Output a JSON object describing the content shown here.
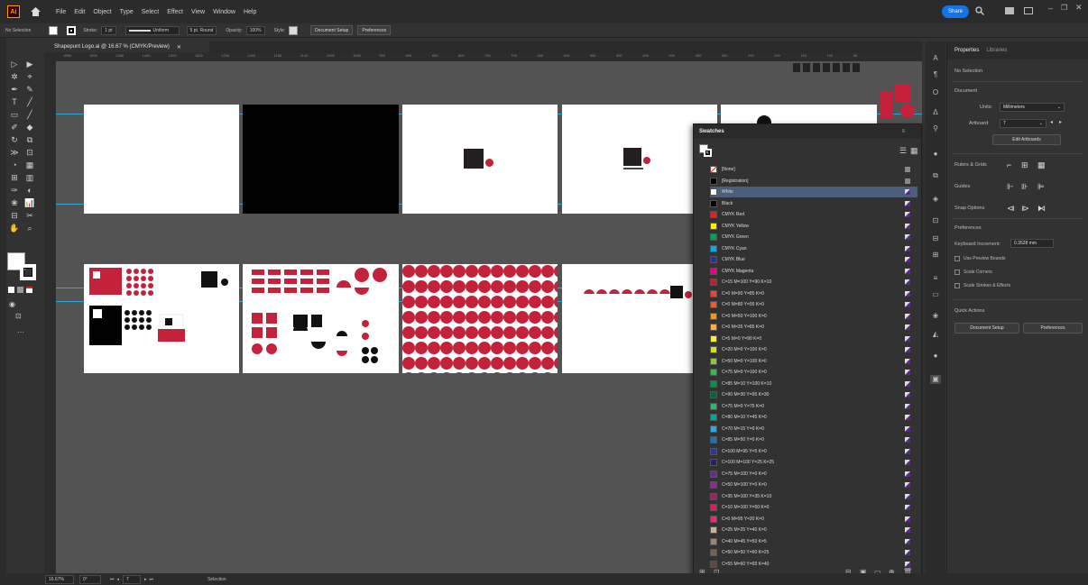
{
  "app": {
    "logo": "Ai"
  },
  "menu": [
    "File",
    "Edit",
    "Object",
    "Type",
    "Select",
    "Effect",
    "View",
    "Window",
    "Help"
  ],
  "share_label": "Share",
  "control_bar": {
    "selection": "No Selection",
    "stroke_label": "Stroke:",
    "stroke_value": "1 pt",
    "profile": "Uniform",
    "brush": "5 pt. Round",
    "opacity_label": "Opacity:",
    "opacity_value": "100%",
    "style_label": "Style:",
    "document_setup": "Document Setup",
    "preferences": "Preferences"
  },
  "document_tab": "Shapepunt Logo.ai @ 16.67 % (CMYK/Preview)",
  "ruler_ticks": [
    "1550",
    "1500",
    "1450",
    "1400",
    "1350",
    "1300",
    "1250",
    "1200",
    "1150",
    "1100",
    "1050",
    "1000",
    "950",
    "900",
    "850",
    "800",
    "750",
    "700",
    "650",
    "600",
    "550",
    "500",
    "450",
    "400",
    "350",
    "300",
    "250",
    "200",
    "150",
    "100",
    "50"
  ],
  "swatches_panel": {
    "title": "Swatches",
    "items": [
      {
        "name": "[None]",
        "color": "none"
      },
      {
        "name": "[Registration]",
        "color": "#000000"
      },
      {
        "name": "White",
        "color": "#ffffff",
        "selected": true
      },
      {
        "name": "Black",
        "color": "#000000"
      },
      {
        "name": "CMYK Red",
        "color": "#ed1c24"
      },
      {
        "name": "CMYK Yellow",
        "color": "#fff200"
      },
      {
        "name": "CMYK Green",
        "color": "#00a651"
      },
      {
        "name": "CMYK Cyan",
        "color": "#00aeef"
      },
      {
        "name": "CMYK Blue",
        "color": "#2e3192"
      },
      {
        "name": "CMYK Magenta",
        "color": "#ec008c"
      },
      {
        "name": "C=15 M=100 Y=90 K=10",
        "color": "#be1e2d"
      },
      {
        "name": "C=0 M=90 Y=85 K=0",
        "color": "#ef4136"
      },
      {
        "name": "C=0 M=80 Y=95 K=0",
        "color": "#f15a29"
      },
      {
        "name": "C=0 M=50 Y=100 K=0",
        "color": "#f7941d"
      },
      {
        "name": "C=0 M=35 Y=85 K=0",
        "color": "#fbb040"
      },
      {
        "name": "C=5 M=0 Y=90 K=0",
        "color": "#f9ed32"
      },
      {
        "name": "C=20 M=0 Y=100 K=0",
        "color": "#d7df23"
      },
      {
        "name": "C=50 M=0 Y=100 K=0",
        "color": "#8dc63f"
      },
      {
        "name": "C=75 M=0 Y=100 K=0",
        "color": "#39b54a"
      },
      {
        "name": "C=85 M=10 Y=100 K=10",
        "color": "#009444"
      },
      {
        "name": "C=90 M=30 Y=95 K=30",
        "color": "#006838"
      },
      {
        "name": "C=75 M=0 Y=75 K=0",
        "color": "#2bb673"
      },
      {
        "name": "C=80 M=10 Y=45 K=0",
        "color": "#00a79d"
      },
      {
        "name": "C=70 M=15 Y=0 K=0",
        "color": "#27aae1"
      },
      {
        "name": "C=85 M=50 Y=0 K=0",
        "color": "#1c75bc"
      },
      {
        "name": "C=100 M=95 Y=5 K=0",
        "color": "#2b3990"
      },
      {
        "name": "C=100 M=100 Y=25 K=25",
        "color": "#262262"
      },
      {
        "name": "C=75 M=100 Y=0 K=0",
        "color": "#662d91"
      },
      {
        "name": "C=50 M=100 Y=0 K=0",
        "color": "#92278f"
      },
      {
        "name": "C=35 M=100 Y=35 K=10",
        "color": "#9e1f63"
      },
      {
        "name": "C=10 M=100 Y=50 K=0",
        "color": "#da1c5c"
      },
      {
        "name": "C=0 M=95 Y=20 K=0",
        "color": "#ee2a7b"
      },
      {
        "name": "C=25 M=25 Y=40 K=0",
        "color": "#c2b59b"
      },
      {
        "name": "C=40 M=45 Y=50 K=5",
        "color": "#998675"
      },
      {
        "name": "C=50 M=50 Y=60 K=25",
        "color": "#736357"
      },
      {
        "name": "C=55 M=60 Y=65 K=40",
        "color": "#594a42"
      }
    ]
  },
  "properties": {
    "tabs": [
      "Properties",
      "Libraries"
    ],
    "no_selection": "No Selection",
    "document_label": "Document",
    "units_label": "Units:",
    "units_value": "Millimeters",
    "artboard_label": "Artboard:",
    "artboard_value": "7",
    "edit_artboards": "Edit Artboards",
    "rulers_grids": "Rulers & Grids",
    "guides": "Guides",
    "snap_options": "Snap Options",
    "preferences_label": "Preferences",
    "keyboard_increment_label": "Keyboard Increment:",
    "keyboard_increment_value": "0.3528 mm",
    "use_preview_bounds": "Use Preview Bounds",
    "scale_corners": "Scale Corners",
    "scale_strokes": "Scale Strokes & Effects",
    "quick_actions": "Quick Actions",
    "document_setup": "Document Setup",
    "preferences_btn": "Preferences"
  },
  "status_bar": {
    "zoom": "16.67%",
    "rotation": "0°",
    "artboard_num": "7",
    "tool": "Selection"
  }
}
